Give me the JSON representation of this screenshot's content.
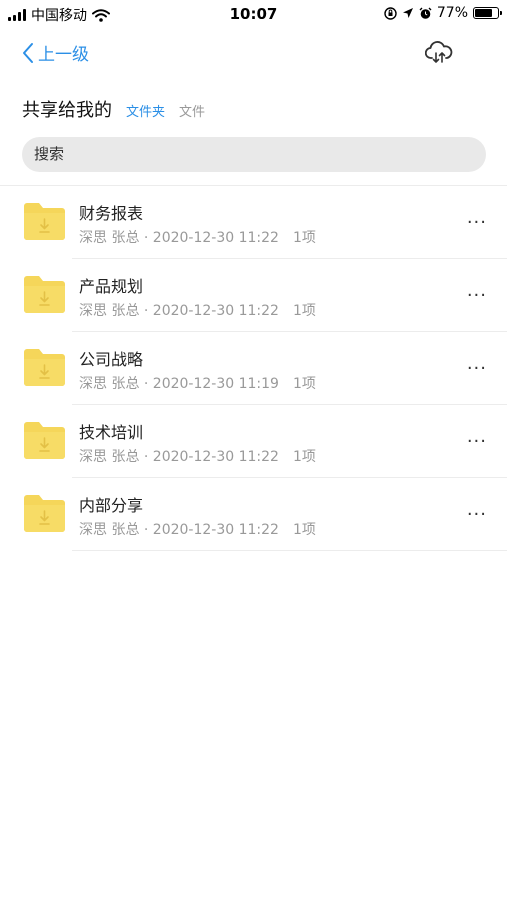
{
  "status_bar": {
    "carrier": "中国移动",
    "time": "10:07",
    "battery": "77%",
    "battery_level": 0.77,
    "icons": [
      "signal-icon",
      "wifi-icon",
      "orientation-lock-icon",
      "location-arrow-icon",
      "alarm-icon",
      "battery-icon"
    ]
  },
  "nav": {
    "back_label": "上一级",
    "back_icon": "chevron-left-icon",
    "action_icon": "cloud-transfer-icon"
  },
  "header": {
    "title": "共享给我的",
    "filter_folder": "文件夹",
    "filter_file": "文件"
  },
  "search": {
    "placeholder": "搜索"
  },
  "folders": [
    {
      "name": "财务报表",
      "meta": "深思 张总 · 2020-12-30 11:22",
      "count": "1项"
    },
    {
      "name": "产品规划",
      "meta": "深思 张总 · 2020-12-30 11:22",
      "count": "1项"
    },
    {
      "name": "公司战略",
      "meta": "深思 张总 · 2020-12-30 11:19",
      "count": "1项"
    },
    {
      "name": "技术培训",
      "meta": "深思 张总 · 2020-12-30 11:22",
      "count": "1项"
    },
    {
      "name": "内部分享",
      "meta": "深思 张总 · 2020-12-30 11:22",
      "count": "1项"
    }
  ],
  "row_icons": {
    "folder": "shared-folder-icon",
    "more": "more-options-icon",
    "more_glyph": "···"
  },
  "colors": {
    "accent": "#2b8fe6",
    "folder": "#f5d65a",
    "folder_tab": "#f0cb46"
  }
}
